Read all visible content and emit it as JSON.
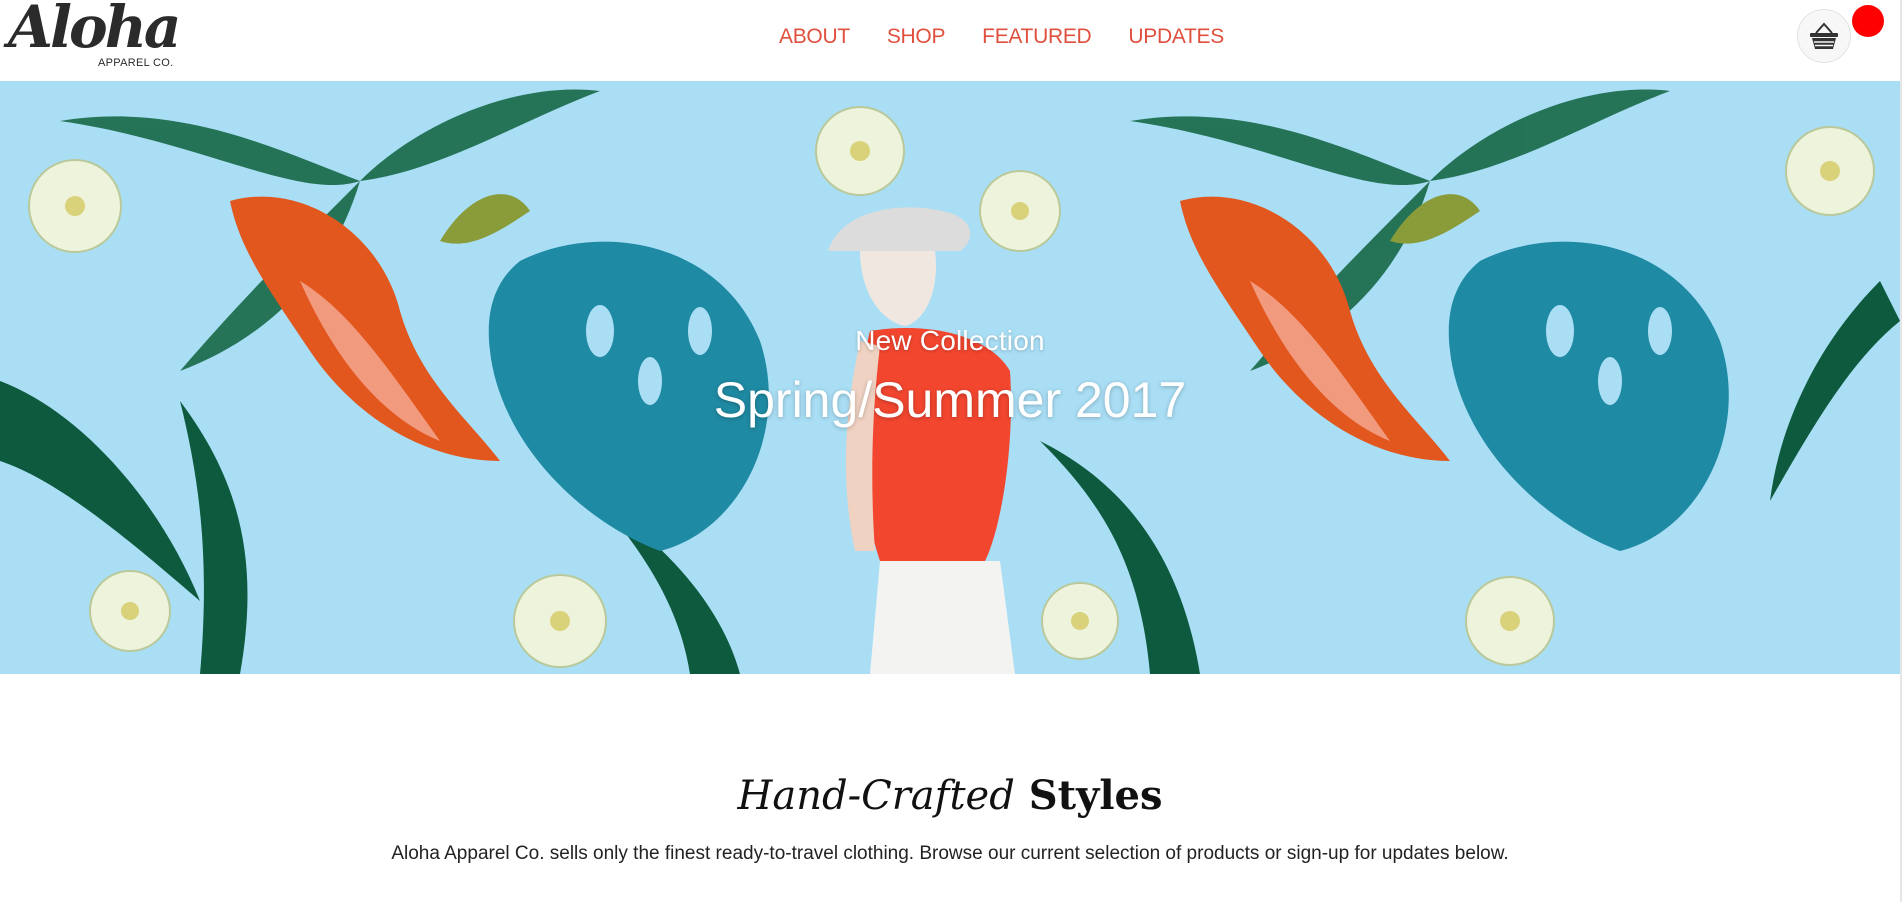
{
  "brand": {
    "name": "Aloha",
    "sub": "APPAREL CO."
  },
  "nav": {
    "items": [
      "ABOUT",
      "SHOP",
      "FEATURED",
      "UPDATES"
    ]
  },
  "cart": {
    "icon": "basket-icon",
    "badge_color": "#ff0000"
  },
  "hero": {
    "kicker": "New Collection",
    "title": "Spring/Summer 2017"
  },
  "section": {
    "heading_italic": "Hand-Crafted",
    "heading_bold": "Styles",
    "body": "Aloha Apparel Co. sells only the finest ready-to-travel clothing. Browse our current selection of products or sign-up for updates below."
  },
  "colors": {
    "accent": "#e0503f",
    "hero_bg": "#a9def5"
  }
}
